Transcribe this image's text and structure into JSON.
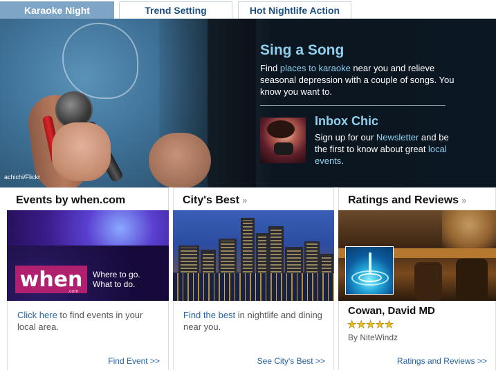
{
  "tabs": [
    {
      "label": "Karaoke Night",
      "active": true
    },
    {
      "label": "Trend Setting",
      "active": false
    },
    {
      "label": "Hot Nightlife Action",
      "active": false
    }
  ],
  "hero": {
    "credit": "achichi/Flickr",
    "title": "Sing a Song",
    "body_before": "Find ",
    "body_link": "places to karaoke",
    "body_after": " near you and relieve seasonal depression with a couple of songs. You know you want to.",
    "inbox": {
      "title": "Inbox Chic",
      "text_before": "Sign up for our ",
      "link1": "Newsletter",
      "text_middle": " and be the first to know about great ",
      "link2": "local events",
      "text_after": "."
    }
  },
  "panels": {
    "events": {
      "title": "Events by when.com",
      "logo_text": "when",
      "logo_sub": ".com",
      "tagline_1": "Where to go.",
      "tagline_2": "What to do.",
      "link": "Click here",
      "text": " to find events in your local area.",
      "more": "Find Event >>"
    },
    "city": {
      "title": "City's Best",
      "chevron": "»",
      "link": "Find the best",
      "text": " in nightlife and dining near you.",
      "more": "See City's Best >>"
    },
    "ratings": {
      "title": "Ratings and Reviews",
      "chevron": "»",
      "name": "Cowan, David MD",
      "stars": "★★★★★",
      "rating": 5,
      "byline": "By NiteWindz",
      "more": "Ratings and Reviews >>"
    }
  }
}
